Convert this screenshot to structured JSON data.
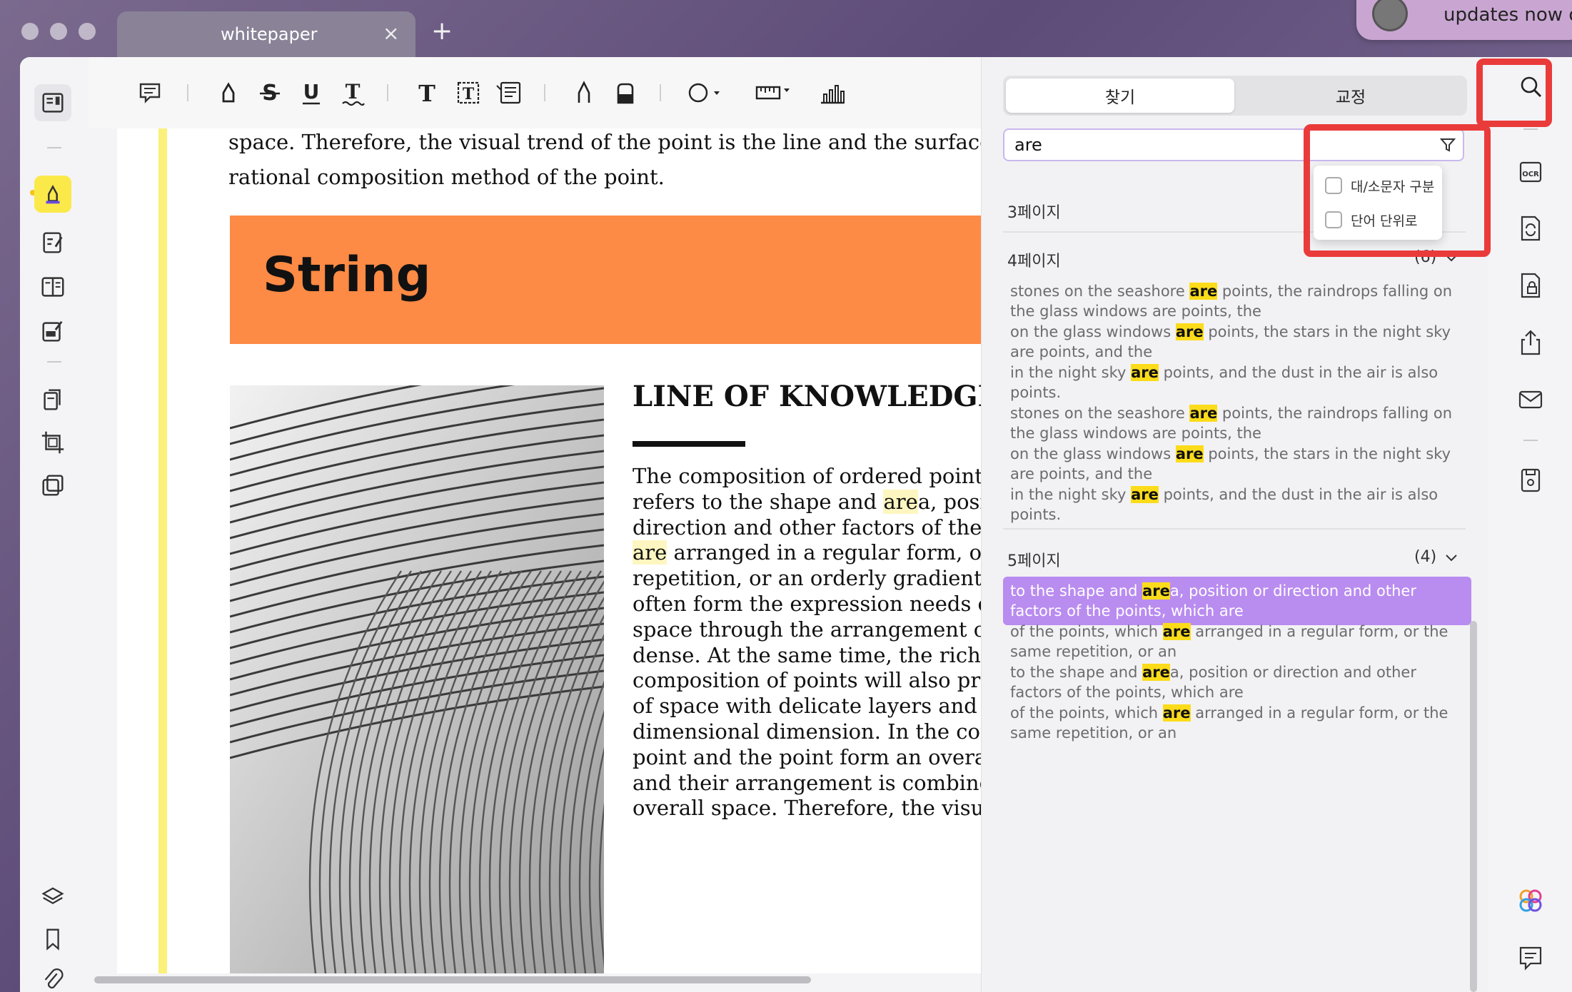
{
  "window": {
    "tab_title": "whitepaper",
    "tab_close": "×",
    "tab_add": "+"
  },
  "notification": {
    "text": "updates now o"
  },
  "toolbar": {
    "tools": [
      "comment-icon",
      "highlighter-icon",
      "strikethrough-icon",
      "underline-icon",
      "squiggly-underline-icon",
      "text-icon",
      "textbox-icon",
      "text-callout-icon",
      "pencil-icon",
      "eraser-icon",
      "shape-icon",
      "measure-icon",
      "chart-icon"
    ]
  },
  "document": {
    "top_lines": [
      "space. Therefore, the visual trend of the point is the line and the surface, wh",
      "rational composition method of the point."
    ],
    "banner_title": "String",
    "banner_color": "#fd8a45",
    "heading": "LINE OF KNOWLEDGE",
    "body_lines": [
      {
        "pre": "The composition of ordered points: ",
        "mark": "",
        "post": "I"
      },
      {
        "pre": "refers to the shape and ",
        "mark": "are",
        "post": "a, positio"
      },
      {
        "pre": "direction and other factors of the po",
        "mark": "",
        "post": ""
      },
      {
        "pre": "",
        "mark": "are",
        "post": " arranged in a regular form, or th"
      },
      {
        "pre": "repetition, or an orderly gradient, etc",
        "mark": "",
        "post": ""
      },
      {
        "pre": "often form the expression needs of g",
        "mark": "",
        "post": ""
      },
      {
        "pre": "space through the arrangement of s",
        "mark": "",
        "post": ""
      },
      {
        "pre": "dense. At the same time, the rich an",
        "mark": "",
        "post": ""
      },
      {
        "pre": "composition of points will also prod",
        "mark": "",
        "post": ""
      },
      {
        "pre": "of space with delicate layers and for",
        "mark": "",
        "post": ""
      },
      {
        "pre": "dimensional dimension. In the com",
        "mark": "",
        "post": ""
      },
      {
        "pre": "point and the point form an overall ",
        "mark": "",
        "post": ""
      },
      {
        "pre": "and their arrangement is combined",
        "mark": "",
        "post": ""
      },
      {
        "pre": "overall space. Therefore, the visual t",
        "mark": "",
        "post": ""
      }
    ]
  },
  "search_panel": {
    "tabs": [
      {
        "label": "찾기",
        "active": true
      },
      {
        "label": "교정",
        "active": false
      }
    ],
    "query": "are",
    "options": [
      {
        "label": "대/소문자 구분",
        "checked": false
      },
      {
        "label": "단어 단위로",
        "checked": false
      }
    ],
    "groups": [
      {
        "page_label": "3페이지",
        "count": "",
        "results": []
      },
      {
        "page_label": "4페이지",
        "count": "(6)",
        "results": [
          {
            "pre": "stones on the seashore ",
            "kw": "are",
            "post": " points, the raindrops falling on the glass windows are points, the",
            "selected": false
          },
          {
            "pre": "on the glass windows ",
            "kw": "are",
            "post": " points, the stars in the night sky are points, and the",
            "selected": false
          },
          {
            "pre": "in the night sky ",
            "kw": "are",
            "post": " points, and the dust in the air is also points.",
            "selected": false
          },
          {
            "pre": "stones on the seashore ",
            "kw": "are",
            "post": " points, the raindrops falling on the glass windows are points, the",
            "selected": false
          },
          {
            "pre": "on the glass windows ",
            "kw": "are",
            "post": " points, the stars in the night sky are points, and the",
            "selected": false
          },
          {
            "pre": "in the night sky ",
            "kw": "are",
            "post": " points, and the dust in the air is also points.",
            "selected": false
          }
        ]
      },
      {
        "page_label": "5페이지",
        "count": "(4)",
        "results": [
          {
            "pre": "to the shape and ",
            "kw": "are",
            "post": "a, position or direction and other factors of the points, which are",
            "selected": true
          },
          {
            "pre": "of the points, which ",
            "kw": "are",
            "post": " arranged in a regular form, or the same repetition, or an",
            "selected": false
          },
          {
            "pre": "to the shape and ",
            "kw": "are",
            "post": "a, position or direction and other factors of the points, which are",
            "selected": false
          },
          {
            "pre": "of the points, which ",
            "kw": "are",
            "post": " arranged in a regular form, or the same repetition, or an",
            "selected": false
          }
        ]
      }
    ]
  },
  "colors": {
    "accent_purple": "#b98cf0",
    "keyword_highlight": "#fcdc1a",
    "callout_red": "#ea3b3b",
    "doc_highlight_bar": "#fbf07a"
  }
}
